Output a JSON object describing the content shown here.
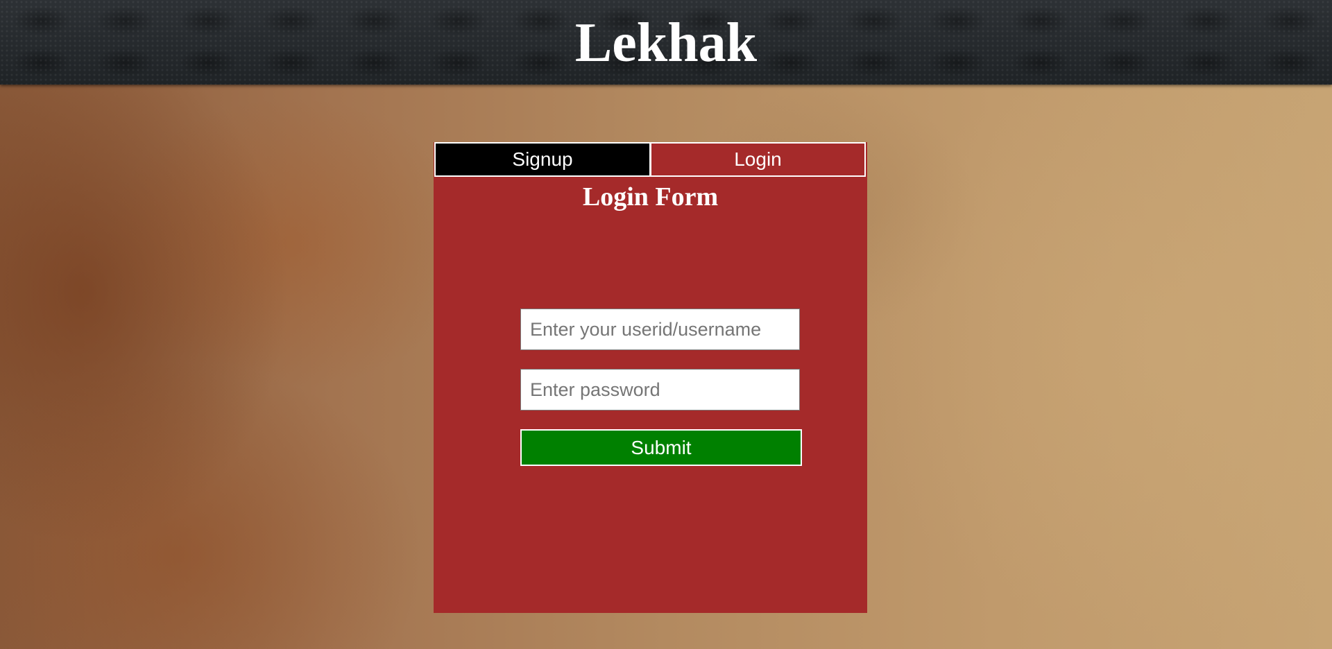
{
  "header": {
    "title": "Lekhak"
  },
  "tabs": [
    {
      "label": "Signup",
      "active": false
    },
    {
      "label": "Login",
      "active": true
    }
  ],
  "form": {
    "title": "Login Form",
    "username_placeholder": "Enter your userid/username",
    "username_value": "",
    "password_placeholder": "Enter password",
    "password_value": "",
    "submit_label": "Submit"
  },
  "colors": {
    "header_bg": "#24282b",
    "panel_bg": "#a52a2a",
    "signup_tab_bg": "#000000",
    "submit_bg": "#008000",
    "text": "#ffffff"
  }
}
